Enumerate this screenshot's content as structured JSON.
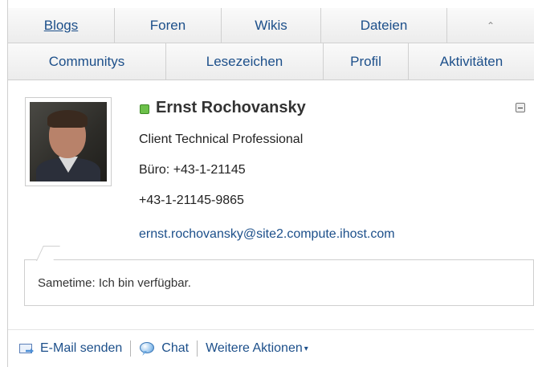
{
  "tabs_row1": [
    {
      "label": "Blogs",
      "active": true
    },
    {
      "label": "Foren"
    },
    {
      "label": "Wikis"
    },
    {
      "label": "Dateien"
    },
    {
      "label": "≙",
      "icon": "scroll-up-icon"
    }
  ],
  "tabs_row2": [
    {
      "label": "Communitys"
    },
    {
      "label": "Lesezeichen"
    },
    {
      "label": "Profil"
    },
    {
      "label": "Aktivitäten"
    }
  ],
  "profile": {
    "name": "Ernst Rochovansky",
    "status_color": "#6cc04a",
    "job_title": "Client Technical Professional",
    "office_phone": "Büro: +43-1-21145",
    "mobile_phone": "+43-1-21145-9865",
    "email": "ernst.rochovansky@site2.compute.ihost.com",
    "sametime": "Sametime:  Ich bin verfügbar."
  },
  "actions": {
    "send_mail": "E-Mail senden",
    "chat": "Chat",
    "more_actions": "Weitere Aktionen"
  },
  "colors": {
    "link": "#1c4f8a",
    "tab_bg": "#f2f2f2",
    "available": "#6cc04a"
  }
}
